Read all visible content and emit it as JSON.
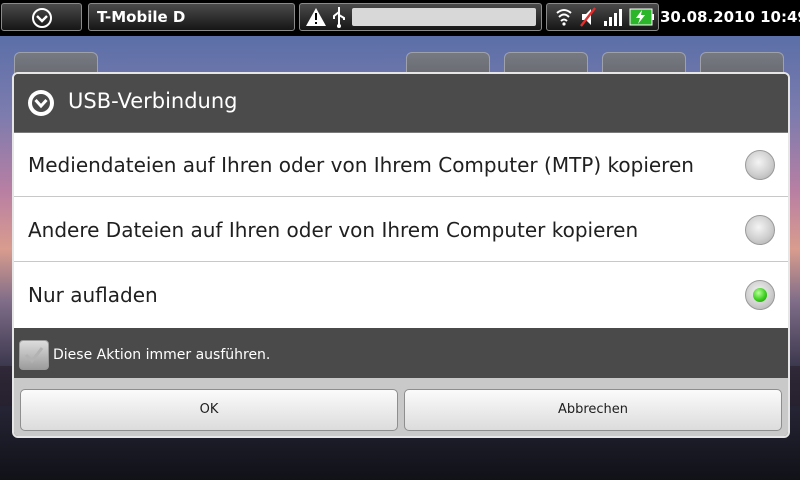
{
  "status_bar": {
    "carrier": "T-Mobile D",
    "datetime": "30.08.2010 10:49",
    "icons": [
      "menu-circle-icon",
      "warning-icon",
      "usb-icon",
      "wifi-icon",
      "mute-icon",
      "signal-icon",
      "battery-charging-icon"
    ]
  },
  "dialog": {
    "title": "USB-Verbindung",
    "options": [
      {
        "label": "Mediendateien auf Ihren oder von Ihrem Computer (MTP) kopieren",
        "selected": false
      },
      {
        "label": "Andere Dateien auf Ihren oder von Ihrem Computer kopieren",
        "selected": false
      },
      {
        "label": "Nur aufladen",
        "selected": true
      }
    ],
    "always_label": "Diese Aktion immer ausführen.",
    "always_checked": false,
    "ok_label": "OK",
    "cancel_label": "Abbrechen"
  },
  "colors": {
    "accent_green": "#3ccf1e",
    "title_bg": "#4b4b4b"
  }
}
